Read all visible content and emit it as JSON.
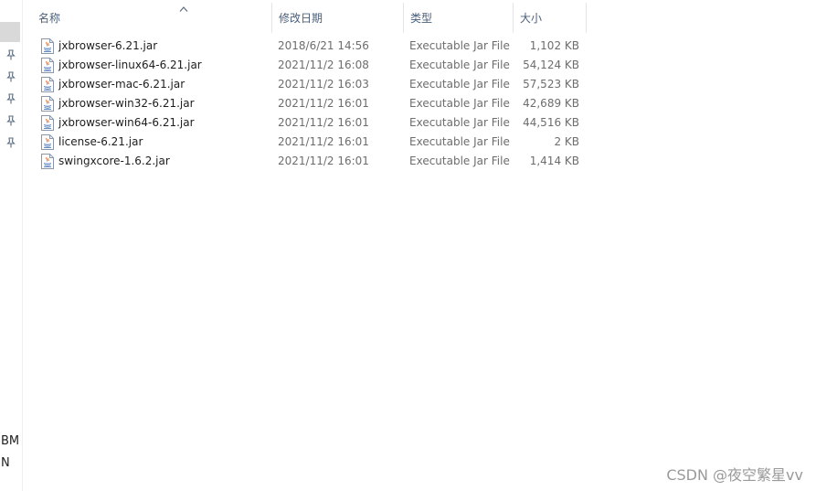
{
  "nav": {
    "fragments": [
      "BM",
      "N"
    ]
  },
  "columns": {
    "name": "名称",
    "date": "修改日期",
    "type": "类型",
    "size": "大小"
  },
  "files": [
    {
      "name": "jxbrowser-6.21.jar",
      "date": "2018/6/21 14:56",
      "type": "Executable Jar File",
      "size": "1,102 KB"
    },
    {
      "name": "jxbrowser-linux64-6.21.jar",
      "date": "2021/11/2 16:08",
      "type": "Executable Jar File",
      "size": "54,124 KB"
    },
    {
      "name": "jxbrowser-mac-6.21.jar",
      "date": "2021/11/2 16:03",
      "type": "Executable Jar File",
      "size": "57,523 KB"
    },
    {
      "name": "jxbrowser-win32-6.21.jar",
      "date": "2021/11/2 16:01",
      "type": "Executable Jar File",
      "size": "42,689 KB"
    },
    {
      "name": "jxbrowser-win64-6.21.jar",
      "date": "2021/11/2 16:01",
      "type": "Executable Jar File",
      "size": "44,516 KB"
    },
    {
      "name": "license-6.21.jar",
      "date": "2021/11/2 16:01",
      "type": "Executable Jar File",
      "size": "2 KB"
    },
    {
      "name": "swingxcore-1.6.2.jar",
      "date": "2021/11/2 16:01",
      "type": "Executable Jar File",
      "size": "1,414 KB"
    }
  ],
  "watermark": "CSDN @夜空繁星vv",
  "icons": {
    "pin": "pin-icon",
    "file": "java-jar-file-icon",
    "sort": "sort-ascending-icon"
  },
  "colors": {
    "header_text": "#4c607a",
    "secondary_text": "#6d6d6d",
    "nav_selected": "#d9d9d9"
  }
}
